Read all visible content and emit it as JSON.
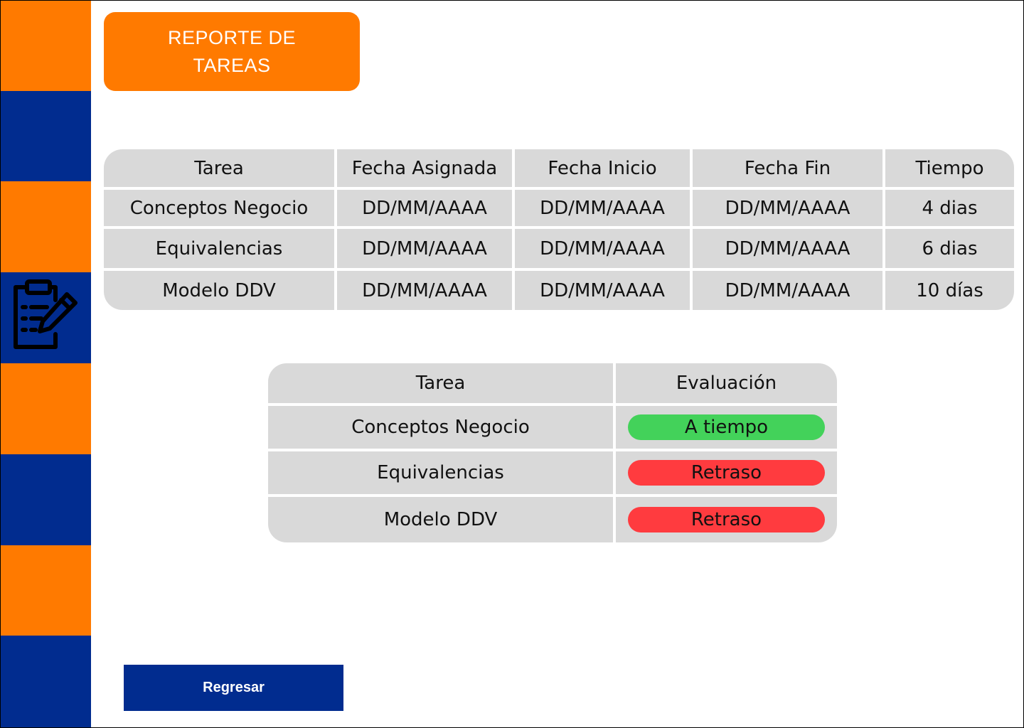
{
  "colors": {
    "orange": "#ff7a00",
    "blue": "#012c8f",
    "cell_bg": "#d9d9d9",
    "on_time": "#43d25a",
    "delayed": "#ff3b3f"
  },
  "sidebar": {
    "icon": "clipboard-edit-icon"
  },
  "header": {
    "title": "REPORTE DE TAREAS"
  },
  "tasks_table": {
    "headers": [
      "Tarea",
      "Fecha Asignada",
      "Fecha Inicio",
      "Fecha Fin",
      "Tiempo"
    ],
    "rows": [
      [
        "Conceptos Negocio",
        "DD/MM/AAAA",
        "DD/MM/AAAA",
        "DD/MM/AAAA",
        "4 dias"
      ],
      [
        "Equivalencias",
        "DD/MM/AAAA",
        "DD/MM/AAAA",
        "DD/MM/AAAA",
        "6 dias"
      ],
      [
        "Modelo DDV",
        "DD/MM/AAAA",
        "DD/MM/AAAA",
        "DD/MM/AAAA",
        "10 días"
      ]
    ]
  },
  "evaluation_table": {
    "headers": [
      "Tarea",
      "Evaluación"
    ],
    "rows": [
      {
        "task": "Conceptos Negocio",
        "status": "A tiempo",
        "status_type": "on_time"
      },
      {
        "task": "Equivalencias",
        "status": "Retraso",
        "status_type": "delayed"
      },
      {
        "task": "Modelo DDV",
        "status": "Retraso",
        "status_type": "delayed"
      }
    ]
  },
  "footer": {
    "back_label": "Regresar"
  }
}
